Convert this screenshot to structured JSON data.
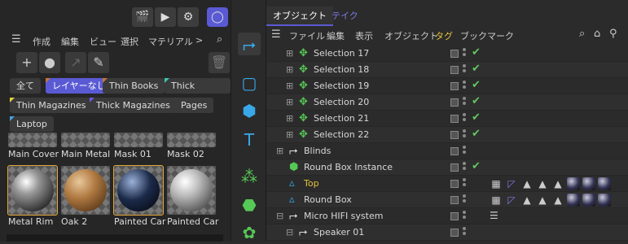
{
  "left_toolbar": {
    "menu": [
      "作成",
      "編集",
      "ビュー",
      "選択",
      "マテリアル"
    ],
    "more": ">"
  },
  "filters": [
    {
      "label": "全て",
      "selected": false,
      "tag_color": ""
    },
    {
      "label": "レイヤーなし",
      "selected": true,
      "tag_color": "#c8743a"
    },
    {
      "label": "Thin Books",
      "selected": false,
      "tag_color": "#c8743a"
    },
    {
      "label": "Thick Books",
      "selected": false,
      "tag_color": "#3ec6b0"
    },
    {
      "label": "Thin Magazines",
      "selected": false,
      "tag_color": "#e4d23a"
    },
    {
      "label": "Thick Magazines",
      "selected": false,
      "tag_color": "#6a5ae0"
    },
    {
      "label": "Pages",
      "selected": false,
      "tag_color": ""
    },
    {
      "label": "Laptop",
      "selected": false,
      "tag_color": "#4aa0e0"
    }
  ],
  "materials_top": [
    "Main Cover",
    "Main Metal",
    "Mask 01",
    "Mask 02"
  ],
  "materials": [
    {
      "label": "Metal Rim",
      "selected": true
    },
    {
      "label": "Oak 2",
      "selected": false
    },
    {
      "label": "Painted Car",
      "selected": true
    },
    {
      "label": "Painted Car",
      "selected": false
    }
  ],
  "tabs": [
    "オブジェクト",
    "テイク"
  ],
  "right_menu": [
    "ファイル",
    "編集",
    "表示",
    "オブジェクト",
    "タグ",
    "ブックマーク"
  ],
  "objects": [
    {
      "name": "Selection 17",
      "check": true
    },
    {
      "name": "Selection 18",
      "check": true
    },
    {
      "name": "Selection 19",
      "check": true
    },
    {
      "name": "Selection 20",
      "check": true
    },
    {
      "name": "Selection 21",
      "check": true
    },
    {
      "name": "Selection 22",
      "check": true
    },
    {
      "name": "Blinds",
      "check": false
    },
    {
      "name": "Round Box Instance",
      "check": true
    },
    {
      "name": "Top",
      "check": false
    },
    {
      "name": "Round Box",
      "check": false
    },
    {
      "name": "Micro HIFI system",
      "check": false
    },
    {
      "name": "Speaker 01",
      "check": false
    }
  ]
}
